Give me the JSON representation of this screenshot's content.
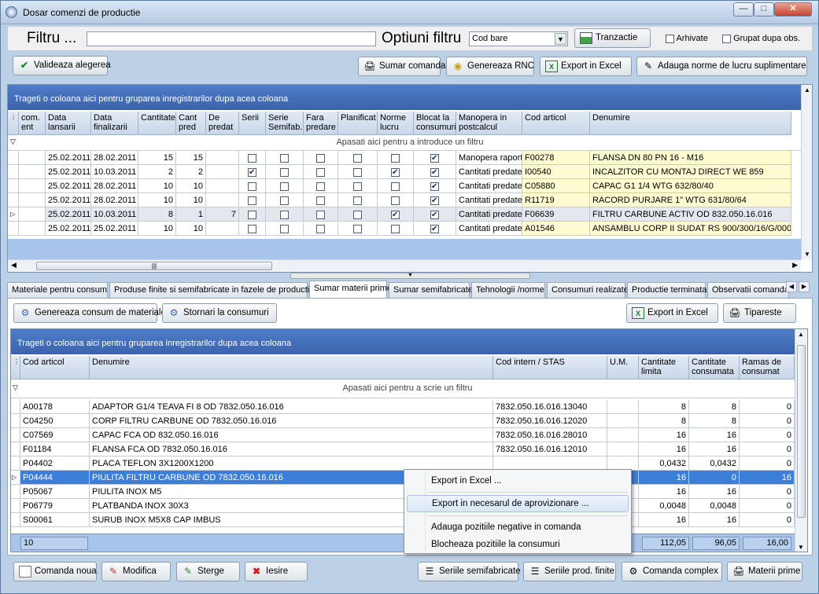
{
  "window": {
    "title": "Dosar comenzi de productie"
  },
  "filter": {
    "label": "Filtru ...",
    "value": "",
    "options_label": "Optiuni filtru",
    "select_value": "Cod bare",
    "tranzactie": "Tranzactie",
    "arhivate": "Arhivate",
    "grupat": "Grupat dupa obs."
  },
  "toolbar": {
    "valideaza": "Valideaza alegerea",
    "sumar": "Sumar comanda",
    "rnc": "Genereaza RNC",
    "export": "Export in Excel",
    "norme": "Adauga norme de lucru suplimentare"
  },
  "grid1": {
    "group_hint": "Trageti o coloana aici pentru gruparea inregistrarilor dupa acea coloana",
    "filter_hint": "Apasati aici pentru a introduce un filtru",
    "columns": [
      "com. ent",
      "Data lansarii",
      "Data finalizarii",
      "Cantitate",
      "Cant pred",
      "De predat",
      "Serii",
      "Serie Semifab.",
      "Fara predare",
      "Planificat",
      "Norme lucru",
      "Blocat la consumuri",
      "Manopera in postcalcul",
      "Cod articol",
      "Denumire"
    ],
    "rows": [
      {
        "d1": "25.02.2011",
        "d2": "28.02.2011",
        "q": "15",
        "cp": "15",
        "dp": "",
        "serii": false,
        "norme": false,
        "blocat": true,
        "man": "Manopera raport",
        "cod": "F00278",
        "den": "FLANSA DN 80 PN 16 - M16"
      },
      {
        "d1": "25.02.2011",
        "d2": "10.03.2011",
        "q": "2",
        "cp": "2",
        "dp": "",
        "serii": true,
        "norme": true,
        "blocat": true,
        "man": "Cantitati predate",
        "cod": "I00540",
        "den": "INCALZITOR CU MONTAJ DIRECT WE 859"
      },
      {
        "d1": "25.02.2011",
        "d2": "28.02.2011",
        "q": "10",
        "cp": "10",
        "dp": "",
        "serii": false,
        "norme": false,
        "blocat": true,
        "man": "Cantitati predate",
        "cod": "C05880",
        "den": "CAPAC G1 1/4 WTG 632/80/40"
      },
      {
        "d1": "25.02.2011",
        "d2": "28.02.2011",
        "q": "10",
        "cp": "10",
        "dp": "",
        "serii": false,
        "norme": false,
        "blocat": true,
        "man": "Cantitati predate",
        "cod": "R11719",
        "den": "RACORD PURJARE 1\" WTG 631/80/64"
      },
      {
        "d1": "25.02.2011",
        "d2": "10.03.2011",
        "q": "8",
        "cp": "1",
        "dp": "7",
        "serii": false,
        "norme": true,
        "blocat": true,
        "man": "Cantitati predate",
        "cod": "F06639",
        "den": "FILTRU CARBUNE ACTIV OD 832.050.16.016"
      },
      {
        "d1": "25.02.2011",
        "d2": "25.02.2011",
        "q": "10",
        "cp": "10",
        "dp": "",
        "serii": false,
        "norme": false,
        "blocat": true,
        "man": "Cantitati predate",
        "cod": "A01546",
        "den": "ANSAMBLU CORP II SUDAT RS 900/300/16/G/000("
      }
    ]
  },
  "tabs": [
    "Materiale pentru consum",
    "Produse finite si semifabricate in fazele de productie",
    "Sumar materii prime",
    "Sumar semifabricate",
    "Tehnologii /norme",
    "Consumuri realizate",
    "Productie terminata",
    "Observatii comanda"
  ],
  "toolbar2": {
    "genereaza": "Genereaza consum de materiale",
    "stornari": "Stornari la consumuri",
    "export": "Export in Excel",
    "tipareste": "Tipareste"
  },
  "grid2": {
    "group_hint": "Trageti o coloana aici pentru gruparea inregistrarilor dupa acea coloana",
    "filter_hint": "Apasati aici pentru a scrie un filtru",
    "columns": [
      "Cod articol",
      "Denumire",
      "Cod intern / STAS",
      "U.M.",
      "Cantitate limita",
      "Cantitate consumata",
      "Ramas de consumat"
    ],
    "rows": [
      {
        "cod": "A00178",
        "den": "ADAPTOR G1/4 TEAVA FI 8 OD 7832.050.16.016",
        "stas": "7832.050.16.016.13040",
        "um": "",
        "lim": "8",
        "cons": "8",
        "ram": "0"
      },
      {
        "cod": "C04250",
        "den": "CORP FILTRU CARBUNE OD 7832.050.16.016",
        "stas": "7832.050.16.016.12020",
        "um": "",
        "lim": "8",
        "cons": "8",
        "ram": "0"
      },
      {
        "cod": "C07569",
        "den": "CAPAC FCA OD 832.050.16.016",
        "stas": "7832.050.16.016.28010",
        "um": "",
        "lim": "16",
        "cons": "16",
        "ram": "0"
      },
      {
        "cod": "F01184",
        "den": "FLANSA FCA OD 7832.050.16.016",
        "stas": "7832.050.16.016.12010",
        "um": "",
        "lim": "16",
        "cons": "16",
        "ram": "0"
      },
      {
        "cod": "P04402",
        "den": "PLACA TEFLON 3X1200X1200",
        "stas": "",
        "um": "",
        "lim": "0,0432",
        "cons": "0,0432",
        "ram": "0"
      },
      {
        "cod": "P04444",
        "den": "PIULITA FILTRU CARBUNE OD 7832.050.16.016",
        "stas": "",
        "um": "",
        "lim": "16",
        "cons": "0",
        "ram": "16"
      },
      {
        "cod": "P05067",
        "den": "PIULITA INOX M5",
        "stas": "",
        "um": "",
        "lim": "16",
        "cons": "16",
        "ram": "0"
      },
      {
        "cod": "P06779",
        "den": "PLATBANDA INOX 30X3",
        "stas": "",
        "um": "",
        "lim": "0,0048",
        "cons": "0,0048",
        "ram": "0"
      },
      {
        "cod": "S00061",
        "den": "SURUB INOX M5X8 CAP IMBUS",
        "stas": "",
        "um": "",
        "lim": "16",
        "cons": "16",
        "ram": "0"
      }
    ],
    "footer": {
      "count": "10",
      "lim": "112,05",
      "cons": "96,05",
      "ram": "16,00"
    }
  },
  "context_menu": [
    "Export in Excel ...",
    "Export in necesarul de aprovizionare ...",
    "Adauga pozitiile negative in comanda",
    "Blocheaza pozitiile la consumuri"
  ],
  "bottom": {
    "noua": "Comanda noua",
    "modifica": "Modifica",
    "sterge": "Sterge",
    "iesire": "Iesire",
    "seriile_semi": "Seriile semifabricate",
    "seriile_prod": "Seriile prod. finite",
    "complex": "Comanda complex",
    "materii": "Materii prime"
  }
}
